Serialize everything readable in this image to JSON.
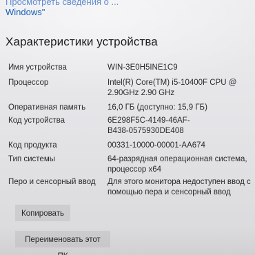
{
  "top_link": {
    "line1": "Просмотреть сведения о ...",
    "line2": "Windows\""
  },
  "section_title": "Характеристики устройства",
  "specs": [
    {
      "label": "Имя устройства",
      "value": "WIN-3E0H5INE1C9"
    },
    {
      "label": "Процессор",
      "value": "Intel(R) Core(TM) i5-10400F CPU @\n2.90GHz   2.90 GHz"
    },
    {
      "label": "Оперативная память",
      "value": "16,0 ГБ (доступно: 15,9 ГБ)"
    },
    {
      "label": "Код устройства",
      "value": "6E298F5C-4149-46AF-\nB438-0575930DE408"
    },
    {
      "label": "Код продукта",
      "value": "00331-10000-00001-AA674"
    },
    {
      "label": "Тип системы",
      "value": "64-разрядная операционная система,\nпроцессор x64"
    },
    {
      "label": "Перо и сенсорный ввод",
      "value": "Для этого монитора недоступен ввод с\nпомощью пера и сенсорный ввод"
    }
  ],
  "buttons": {
    "copy_label": "Копировать",
    "rename_label": "Переименовать этот ПК"
  },
  "colors": {
    "link": "#1a5fb4",
    "background": "#e6e6e9",
    "button": "#cdcdd0",
    "text": "#2a2a2d"
  }
}
